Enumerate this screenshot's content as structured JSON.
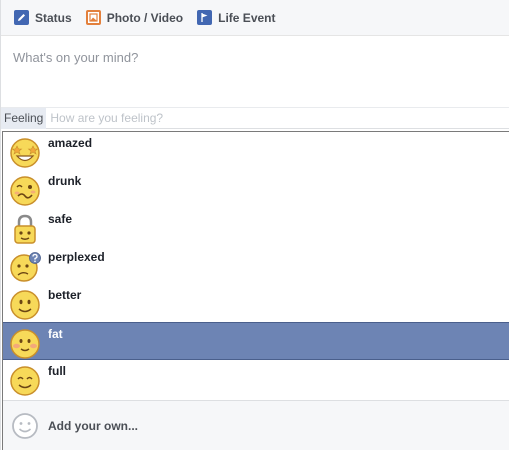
{
  "tabs": [
    {
      "label": "Status",
      "icon": "pencil-icon"
    },
    {
      "label": "Photo / Video",
      "icon": "photo-icon"
    },
    {
      "label": "Life Event",
      "icon": "flag-icon"
    }
  ],
  "composer": {
    "placeholder": "What's on your mind?"
  },
  "feeling": {
    "tag": "Feeling",
    "placeholder": "How are you feeling?"
  },
  "feelings": [
    {
      "label": "amazed",
      "icon": "amazed-emoji-icon"
    },
    {
      "label": "drunk",
      "icon": "drunk-emoji-icon"
    },
    {
      "label": "safe",
      "icon": "safe-lock-emoji-icon"
    },
    {
      "label": "perplexed",
      "icon": "perplexed-emoji-icon"
    },
    {
      "label": "better",
      "icon": "better-emoji-icon"
    },
    {
      "label": "fat",
      "icon": "fat-emoji-icon",
      "selected": true
    },
    {
      "label": "full",
      "icon": "full-emoji-icon"
    }
  ],
  "add_own": {
    "label": "Add your own...",
    "icon": "smiley-outline-icon"
  },
  "colors": {
    "accent": "#4267b2",
    "selected_row": "#6d84b4",
    "emoji_fill": "#f7d959",
    "emoji_stroke": "#c98f2b"
  }
}
